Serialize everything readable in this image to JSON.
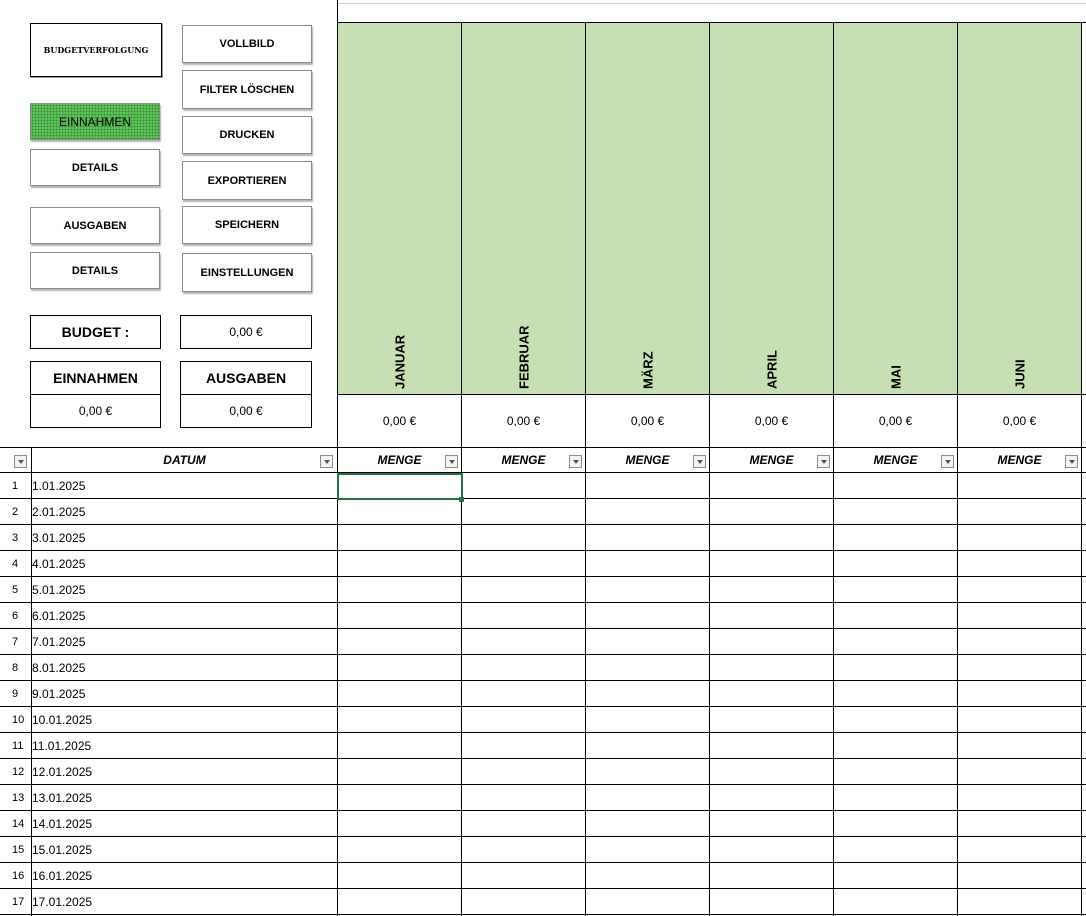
{
  "left_panel": {
    "title": "BUDGETVERFOLGUNG",
    "buttons_left": [
      {
        "label": "EINNAHMEN",
        "active": true
      },
      {
        "label": "DETAILS"
      },
      {
        "label": "AUSGABEN"
      },
      {
        "label": "DETAILS"
      }
    ],
    "buttons_right": [
      {
        "label": "VOLLBILD"
      },
      {
        "label": "FILTER LÖSCHEN"
      },
      {
        "label": "DRUCKEN"
      },
      {
        "label": "EXPORTIEREN"
      },
      {
        "label": "SPEICHERN"
      },
      {
        "label": "EINSTELLUNGEN"
      }
    ],
    "budget_label": "BUDGET :",
    "budget_value": "0,00 €",
    "income_label": "EINNAHMEN",
    "income_value": "0,00 €",
    "expense_label": "AUSGABEN",
    "expense_value": "0,00 €"
  },
  "months": [
    {
      "name": "JANUAR",
      "total": "0,00 €",
      "header": "MENGE"
    },
    {
      "name": "FEBRUAR",
      "total": "0,00 €",
      "header": "MENGE"
    },
    {
      "name": "MÄRZ",
      "total": "0,00 €",
      "header": "MENGE"
    },
    {
      "name": "APRIL",
      "total": "0,00 €",
      "header": "MENGE"
    },
    {
      "name": "MAI",
      "total": "0,00 €",
      "header": "MENGE"
    },
    {
      "name": "JUNI",
      "total": "0,00 €",
      "header": "MENGE"
    }
  ],
  "table": {
    "date_header": "DATUM",
    "rows": [
      {
        "n": "1",
        "date": "1.01.2025"
      },
      {
        "n": "2",
        "date": "2.01.2025"
      },
      {
        "n": "3",
        "date": "3.01.2025"
      },
      {
        "n": "4",
        "date": "4.01.2025"
      },
      {
        "n": "5",
        "date": "5.01.2025"
      },
      {
        "n": "6",
        "date": "6.01.2025"
      },
      {
        "n": "7",
        "date": "7.01.2025"
      },
      {
        "n": "8",
        "date": "8.01.2025"
      },
      {
        "n": "9",
        "date": "9.01.2025"
      },
      {
        "n": "10",
        "date": "10.01.2025"
      },
      {
        "n": "11",
        "date": "11.01.2025"
      },
      {
        "n": "12",
        "date": "12.01.2025"
      },
      {
        "n": "13",
        "date": "13.01.2025"
      },
      {
        "n": "14",
        "date": "14.01.2025"
      },
      {
        "n": "15",
        "date": "15.01.2025"
      },
      {
        "n": "16",
        "date": "16.01.2025"
      },
      {
        "n": "17",
        "date": "17.01.2025"
      }
    ]
  },
  "colors": {
    "month_fill": "#c6e0b4",
    "active_button": "#5fbf5a",
    "selection": "#217346"
  }
}
